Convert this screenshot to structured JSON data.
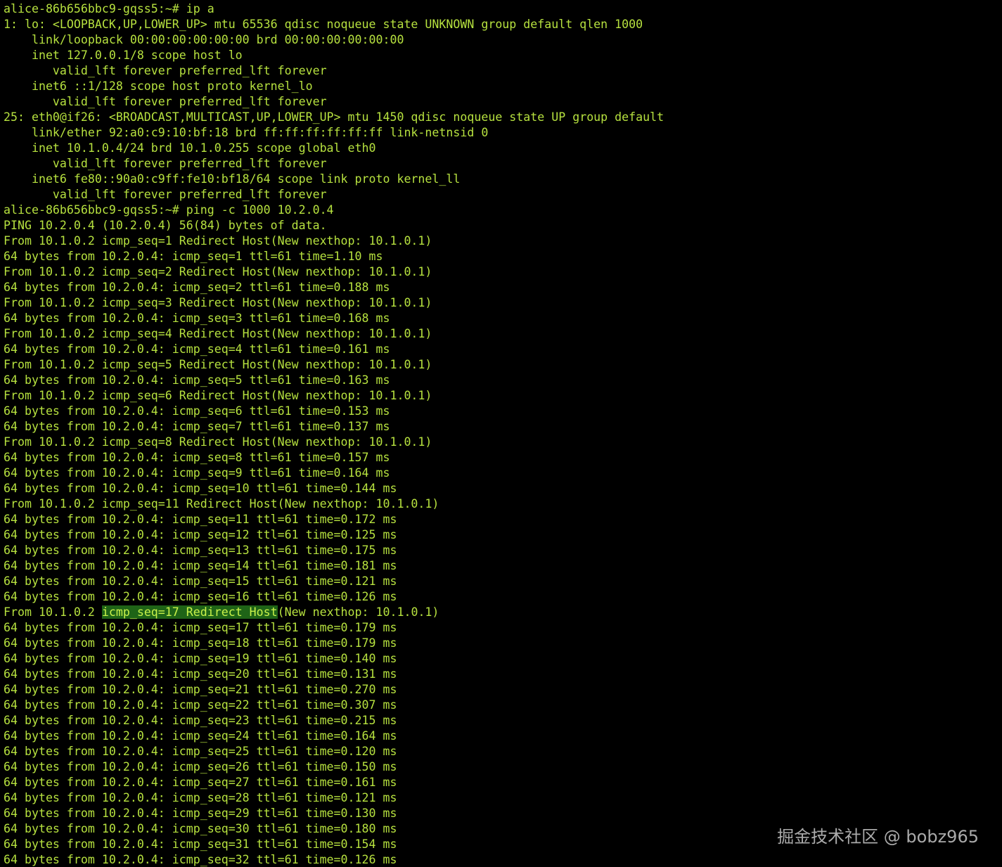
{
  "terminal": {
    "lines": [
      "alice-86b656bbc9-gqss5:~# ip a",
      "1: lo: <LOOPBACK,UP,LOWER_UP> mtu 65536 qdisc noqueue state UNKNOWN group default qlen 1000",
      "    link/loopback 00:00:00:00:00:00 brd 00:00:00:00:00:00",
      "    inet 127.0.0.1/8 scope host lo",
      "       valid_lft forever preferred_lft forever",
      "    inet6 ::1/128 scope host proto kernel_lo",
      "       valid_lft forever preferred_lft forever",
      "25: eth0@if26: <BROADCAST,MULTICAST,UP,LOWER_UP> mtu 1450 qdisc noqueue state UP group default",
      "    link/ether 92:a0:c9:10:bf:18 brd ff:ff:ff:ff:ff:ff link-netnsid 0",
      "    inet 10.1.0.4/24 brd 10.1.0.255 scope global eth0",
      "       valid_lft forever preferred_lft forever",
      "    inet6 fe80::90a0:c9ff:fe10:bf18/64 scope link proto kernel_ll",
      "       valid_lft forever preferred_lft forever",
      "alice-86b656bbc9-gqss5:~# ping -c 1000 10.2.0.4",
      "PING 10.2.0.4 (10.2.0.4) 56(84) bytes of data.",
      "From 10.1.0.2 icmp_seq=1 Redirect Host(New nexthop: 10.1.0.1)",
      "64 bytes from 10.2.0.4: icmp_seq=1 ttl=61 time=1.10 ms",
      "From 10.1.0.2 icmp_seq=2 Redirect Host(New nexthop: 10.1.0.1)",
      "64 bytes from 10.2.0.4: icmp_seq=2 ttl=61 time=0.188 ms",
      "From 10.1.0.2 icmp_seq=3 Redirect Host(New nexthop: 10.1.0.1)",
      "64 bytes from 10.2.0.4: icmp_seq=3 ttl=61 time=0.168 ms",
      "From 10.1.0.2 icmp_seq=4 Redirect Host(New nexthop: 10.1.0.1)",
      "64 bytes from 10.2.0.4: icmp_seq=4 ttl=61 time=0.161 ms",
      "From 10.1.0.2 icmp_seq=5 Redirect Host(New nexthop: 10.1.0.1)",
      "64 bytes from 10.2.0.4: icmp_seq=5 ttl=61 time=0.163 ms",
      "From 10.1.0.2 icmp_seq=6 Redirect Host(New nexthop: 10.1.0.1)",
      "64 bytes from 10.2.0.4: icmp_seq=6 ttl=61 time=0.153 ms",
      "64 bytes from 10.2.0.4: icmp_seq=7 ttl=61 time=0.137 ms",
      "From 10.1.0.2 icmp_seq=8 Redirect Host(New nexthop: 10.1.0.1)",
      "64 bytes from 10.2.0.4: icmp_seq=8 ttl=61 time=0.157 ms",
      "64 bytes from 10.2.0.4: icmp_seq=9 ttl=61 time=0.164 ms",
      "64 bytes from 10.2.0.4: icmp_seq=10 ttl=61 time=0.144 ms",
      "From 10.1.0.2 icmp_seq=11 Redirect Host(New nexthop: 10.1.0.1)",
      "64 bytes from 10.2.0.4: icmp_seq=11 ttl=61 time=0.172 ms",
      "64 bytes from 10.2.0.4: icmp_seq=12 ttl=61 time=0.125 ms",
      "64 bytes from 10.2.0.4: icmp_seq=13 ttl=61 time=0.175 ms",
      "64 bytes from 10.2.0.4: icmp_seq=14 ttl=61 time=0.181 ms",
      "64 bytes from 10.2.0.4: icmp_seq=15 ttl=61 time=0.121 ms",
      "64 bytes from 10.2.0.4: icmp_seq=16 ttl=61 time=0.126 ms",
      {
        "pre": "From 10.1.0.2 ",
        "sel": "icmp_seq=17 Redirect Host",
        "post": "(New nexthop: 10.1.0.1)"
      },
      "64 bytes from 10.2.0.4: icmp_seq=17 ttl=61 time=0.179 ms",
      "64 bytes from 10.2.0.4: icmp_seq=18 ttl=61 time=0.179 ms",
      "64 bytes from 10.2.0.4: icmp_seq=19 ttl=61 time=0.140 ms",
      "64 bytes from 10.2.0.4: icmp_seq=20 ttl=61 time=0.131 ms",
      "64 bytes from 10.2.0.4: icmp_seq=21 ttl=61 time=0.270 ms",
      "64 bytes from 10.2.0.4: icmp_seq=22 ttl=61 time=0.307 ms",
      "64 bytes from 10.2.0.4: icmp_seq=23 ttl=61 time=0.215 ms",
      "64 bytes from 10.2.0.4: icmp_seq=24 ttl=61 time=0.164 ms",
      "64 bytes from 10.2.0.4: icmp_seq=25 ttl=61 time=0.120 ms",
      "64 bytes from 10.2.0.4: icmp_seq=26 ttl=61 time=0.150 ms",
      "64 bytes from 10.2.0.4: icmp_seq=27 ttl=61 time=0.161 ms",
      "64 bytes from 10.2.0.4: icmp_seq=28 ttl=61 time=0.121 ms",
      "64 bytes from 10.2.0.4: icmp_seq=29 ttl=61 time=0.130 ms",
      "64 bytes from 10.2.0.4: icmp_seq=30 ttl=61 time=0.180 ms",
      "64 bytes from 10.2.0.4: icmp_seq=31 ttl=61 time=0.154 ms",
      "64 bytes from 10.2.0.4: icmp_seq=32 ttl=61 time=0.126 ms"
    ]
  },
  "watermark": "掘金技术社区 @ bobz965",
  "colors": {
    "background": "#000000",
    "text": "#b7e23f",
    "selection": "#1f6417"
  }
}
